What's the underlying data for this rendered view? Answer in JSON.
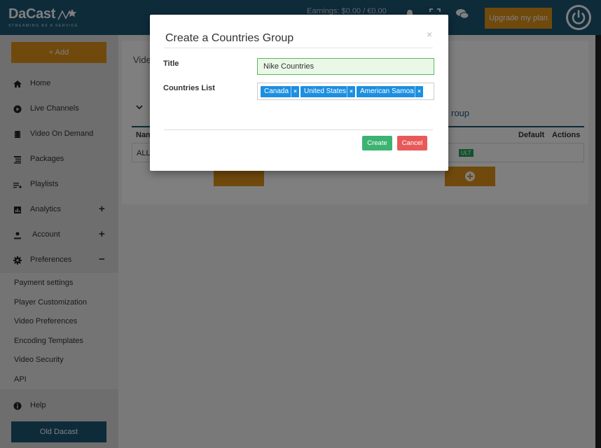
{
  "header": {
    "logo": "DaCast",
    "tagline": "STREAMING AS A SERVICE",
    "earnings": "Earnings: $0.00 / €0.00",
    "upgrade_label": "Upgrade my plan"
  },
  "sidebar": {
    "add_label": "+ Add",
    "items": [
      {
        "label": "Home",
        "icon": "home-icon"
      },
      {
        "label": "Live Channels",
        "icon": "play-icon"
      },
      {
        "label": "Video On Demand",
        "icon": "film-icon"
      },
      {
        "label": "Packages",
        "icon": "list-icon"
      },
      {
        "label": "Playlists",
        "icon": "playlist-icon"
      },
      {
        "label": "Analytics",
        "icon": "chart-icon",
        "expand": "+"
      },
      {
        "label": "Account",
        "icon": "user-icon",
        "expand": "+"
      },
      {
        "label": "Preferences",
        "icon": "gear-icon",
        "expand": "−"
      }
    ],
    "submenu": [
      "Payment settings",
      "Player Customization",
      "Video Preferences",
      "Encoding Templates",
      "Video Security",
      "API"
    ],
    "help_label": "Help",
    "old_label": "Old Dacast"
  },
  "main": {
    "tab_label": "Video",
    "group_heading": "roup",
    "col_name": "Nam",
    "col_default": "Default",
    "col_actions": "Actions",
    "row_all": "ALL",
    "badge": "ULT"
  },
  "modal": {
    "title": "Create a Countries Group",
    "close": "×",
    "title_label": "Title",
    "title_value": "Nike Countries",
    "countries_label": "Countries List",
    "countries": [
      "Canada",
      "United States",
      "American Samoa"
    ],
    "create_label": "Create",
    "cancel_label": "Cancel"
  }
}
